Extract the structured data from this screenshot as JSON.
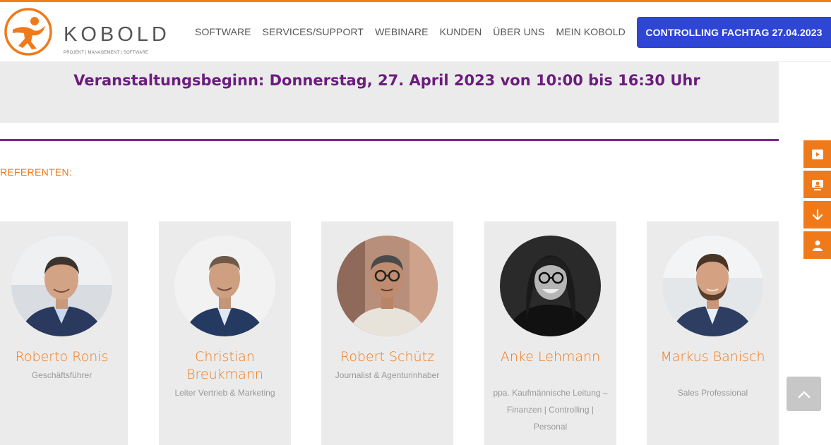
{
  "header": {
    "logo_word": "KOBOLD",
    "logo_sub": "PROJEKT | MANAGEMENT | SOFTWARE",
    "nav": [
      "SOFTWARE",
      "SERVICES/SUPPORT",
      "WEBINARE",
      "KUNDEN",
      "ÜBER UNS",
      "MEIN KOBOLD"
    ],
    "cta_label": "CONTROLLING FACHTAG 27.04.2023"
  },
  "event": {
    "start_text": "Veranstaltungsbeginn: Donnerstag, 27. April 2023 von 10:00 bis 16:30 Uhr"
  },
  "speakers_section": {
    "title": "REFERENTEN:",
    "speakers": [
      {
        "name": "Roberto Ronis",
        "role": "Geschäftsführer"
      },
      {
        "name": "Christian Breukmann",
        "role": "Leiter Vertrieb & Marketing"
      },
      {
        "name": "Robert Schütz",
        "role": "Journalist & Agenturinhaber"
      },
      {
        "name": "Anke Lehmann",
        "role": "ppa. Kaufmännische Leitung – Finanzen | Controlling | Personal"
      },
      {
        "name": "Markus Banisch",
        "role": "Sales Professional"
      }
    ]
  },
  "side_tools": [
    "video-icon",
    "webinar-screen-icon",
    "download-icon",
    "user-icon"
  ],
  "scroll_top_icon": "chevron-up-icon",
  "colors": {
    "brand_orange": "#f07a1a",
    "cta_blue": "#2f45d6",
    "event_purple": "#6b1d7e",
    "card_bg": "#ebebeb"
  }
}
